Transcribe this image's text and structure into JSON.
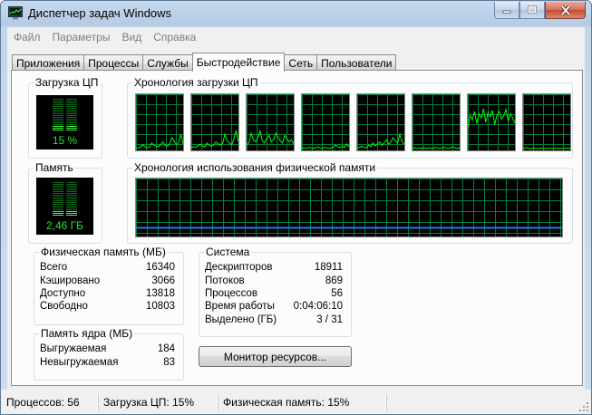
{
  "window": {
    "title": "Диспетчер задач Windows"
  },
  "menu": [
    "Файл",
    "Параметры",
    "Вид",
    "Справка"
  ],
  "tabs": [
    {
      "label": "Приложения",
      "active": false
    },
    {
      "label": "Процессы",
      "active": false
    },
    {
      "label": "Службы",
      "active": false
    },
    {
      "label": "Быстродействие",
      "active": true
    },
    {
      "label": "Сеть",
      "active": false
    },
    {
      "label": "Пользователи",
      "active": false
    }
  ],
  "cpu": {
    "label": "Загрузка ЦП",
    "value_text": "15 %",
    "percent": 15,
    "history_label": "Хронология загрузки ЦП",
    "cores": [
      [
        2,
        3,
        4,
        9,
        5,
        3,
        4,
        12,
        8,
        6,
        5,
        9,
        14,
        8,
        6,
        10,
        22,
        15,
        9,
        12,
        28,
        10
      ],
      [
        3,
        5,
        4,
        7,
        10,
        6,
        5,
        12,
        8,
        6,
        9,
        14,
        10,
        8,
        12,
        28,
        16,
        12,
        9,
        20,
        35,
        14
      ],
      [
        8,
        12,
        30,
        18,
        14,
        22,
        34,
        16,
        12,
        20,
        26,
        14,
        18,
        30,
        22,
        16,
        12,
        26,
        20,
        14,
        18,
        10
      ],
      [
        2,
        3,
        2,
        4,
        3,
        2,
        3,
        5,
        3,
        2,
        4,
        3,
        2,
        3,
        4,
        8,
        5,
        3,
        6,
        4,
        10,
        5
      ],
      [
        3,
        4,
        6,
        4,
        3,
        8,
        5,
        12,
        7,
        10,
        14,
        8,
        12,
        18,
        10,
        14,
        22,
        16,
        12,
        28,
        14,
        10
      ],
      [
        2,
        3,
        2,
        3,
        2,
        4,
        2,
        3,
        3,
        2,
        4,
        3,
        2,
        3,
        4,
        3,
        2,
        3,
        5,
        3,
        2,
        3
      ],
      [
        40,
        62,
        55,
        70,
        48,
        66,
        58,
        75,
        50,
        68,
        60,
        72,
        46,
        64,
        70,
        56,
        62,
        74,
        52,
        66,
        58,
        48
      ],
      [
        2,
        2,
        3,
        2,
        2,
        3,
        2,
        2,
        3,
        2,
        2,
        2,
        3,
        2,
        2,
        3,
        2,
        2,
        2,
        3,
        2,
        2
      ]
    ]
  },
  "memory": {
    "label": "Память",
    "value_text": "2,46 ГБ",
    "percent": 15,
    "history_label": "Хронология использования физической памяти",
    "history_percent": 15
  },
  "physical_memory": {
    "title": "Физическая память (МБ)",
    "rows": [
      {
        "k": "Всего",
        "v": "16340"
      },
      {
        "k": "Кэшировано",
        "v": "3066"
      },
      {
        "k": "Доступно",
        "v": "13818"
      },
      {
        "k": "Свободно",
        "v": "10803"
      }
    ]
  },
  "kernel_memory": {
    "title": "Память ядра (МБ)",
    "rows": [
      {
        "k": "Выгружаемая",
        "v": "184"
      },
      {
        "k": "Невыгружаемая",
        "v": "83"
      }
    ]
  },
  "system": {
    "title": "Система",
    "rows": [
      {
        "k": "Дескрипторов",
        "v": "18911"
      },
      {
        "k": "Потоков",
        "v": "869"
      },
      {
        "k": "Процессов",
        "v": "56"
      },
      {
        "k": "Время работы",
        "v": "0:04:06:10"
      },
      {
        "k": "Выделено (ГБ)",
        "v": "3 / 31"
      }
    ]
  },
  "resource_monitor_button": "Монитор ресурсов...",
  "status": {
    "processes": "Процессов: 56",
    "cpu": "Загрузка ЦП: 15%",
    "memory": "Физическая память: 15%"
  },
  "colors": {
    "graph_green": "#00ff00",
    "grid": "#008040",
    "memory_line": "#1e7fe8",
    "meter_text": "#28e430"
  }
}
